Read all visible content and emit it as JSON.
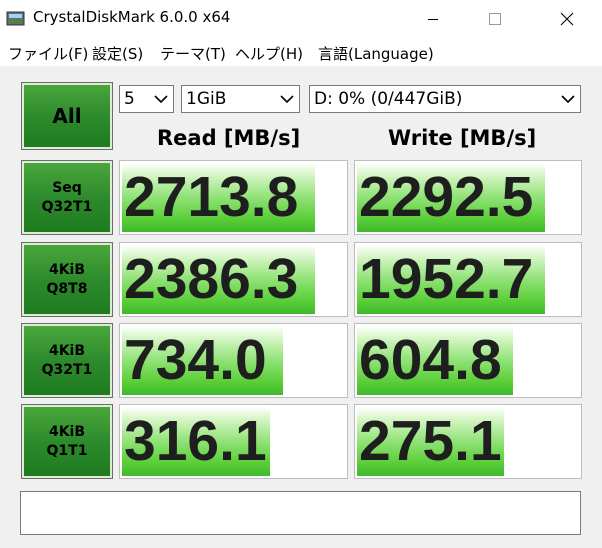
{
  "window": {
    "title": "CrystalDiskMark 6.0.0 x64"
  },
  "menu": [
    "ファイル(F)",
    "設定(S)",
    "テーマ(T)",
    "ヘルプ(H)",
    "言語(Language)"
  ],
  "controls": {
    "all_label": "All",
    "count": "5",
    "size": "1GiB",
    "drive": "D: 0% (0/447GiB)"
  },
  "headers": {
    "read": "Read [MB/s]",
    "write": "Write [MB/s]"
  },
  "tests": [
    {
      "line1": "Seq",
      "line2": "Q32T1",
      "read": "2713.8",
      "write": "2292.5",
      "read_fill": 0.86,
      "write_fill": 0.84
    },
    {
      "line1": "4KiB",
      "line2": "Q8T8",
      "read": "2386.3",
      "write": "1952.7",
      "read_fill": 0.86,
      "write_fill": 0.84
    },
    {
      "line1": "4KiB",
      "line2": "Q32T1",
      "read": "734.0",
      "write": "604.8",
      "read_fill": 0.72,
      "write_fill": 0.7
    },
    {
      "line1": "4KiB",
      "line2": "Q1T1",
      "read": "316.1",
      "write": "275.1",
      "read_fill": 0.66,
      "write_fill": 0.66
    }
  ],
  "comment": ""
}
